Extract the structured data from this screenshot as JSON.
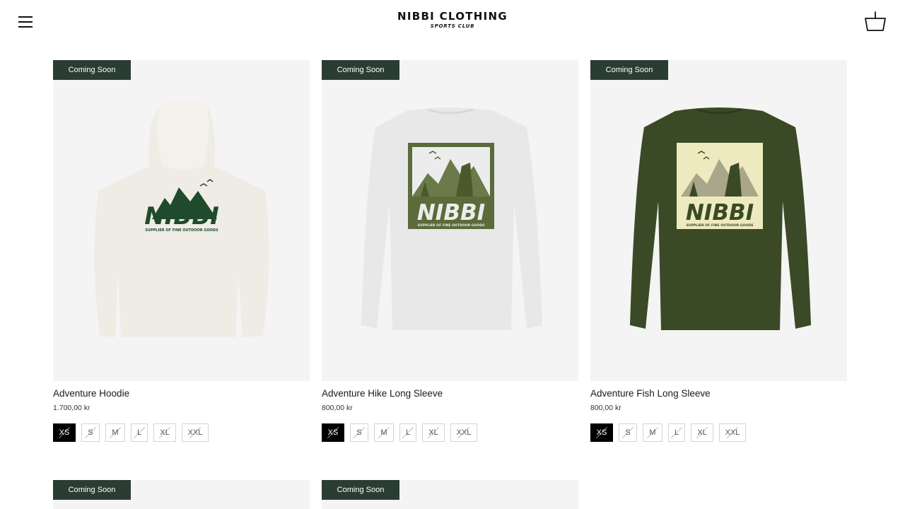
{
  "header": {
    "brand_title": "NIBBI CLOTHING",
    "brand_subtitle": "SPORTS CLUB",
    "menu_icon": "hamburger-menu-icon",
    "cart_icon": "basket-icon"
  },
  "products": [
    {
      "badge": "Coming Soon",
      "title": "Adventure Hoodie",
      "price": "1.700,00 kr",
      "garment": "hoodie",
      "garment_color": "#efece5",
      "print_color": "#1f4a2c",
      "sizes": [
        "XS",
        "S",
        "M",
        "L",
        "XL",
        "XXL"
      ],
      "selected_size": "XS",
      "logo_text": "NIBBI",
      "logo_tagline": "SUPPLIER OF FINE OUTDOOR GOODS"
    },
    {
      "badge": "Coming Soon",
      "title": "Adventure Hike Long Sleeve",
      "price": "800,00 kr",
      "garment": "long-sleeve",
      "garment_color": "#e8e8e8",
      "print_color": "#5b6b3a",
      "sizes": [
        "XS",
        "S",
        "M",
        "L",
        "XL",
        "XXL"
      ],
      "selected_size": "XS",
      "logo_text": "NIBBI",
      "logo_tagline": "SUPPLIER OF FINE OUTDOOR GOODS"
    },
    {
      "badge": "Coming Soon",
      "title": "Adventure Fish Long Sleeve",
      "price": "800,00 kr",
      "garment": "long-sleeve",
      "garment_color": "#3b4a26",
      "print_color": "#eeeabf",
      "sizes": [
        "XS",
        "S",
        "M",
        "L",
        "XL",
        "XXL"
      ],
      "selected_size": "XS",
      "logo_text": "NIBBI",
      "logo_tagline": "SUPPLIER OF FINE OUTDOOR GOODS"
    }
  ],
  "next_row": [
    {
      "badge": "Coming Soon"
    },
    {
      "badge": "Coming Soon"
    }
  ],
  "colors": {
    "badge_bg": "#2b3d33",
    "image_bg": "#f4f4f4",
    "selected_size_bg": "#000000"
  }
}
